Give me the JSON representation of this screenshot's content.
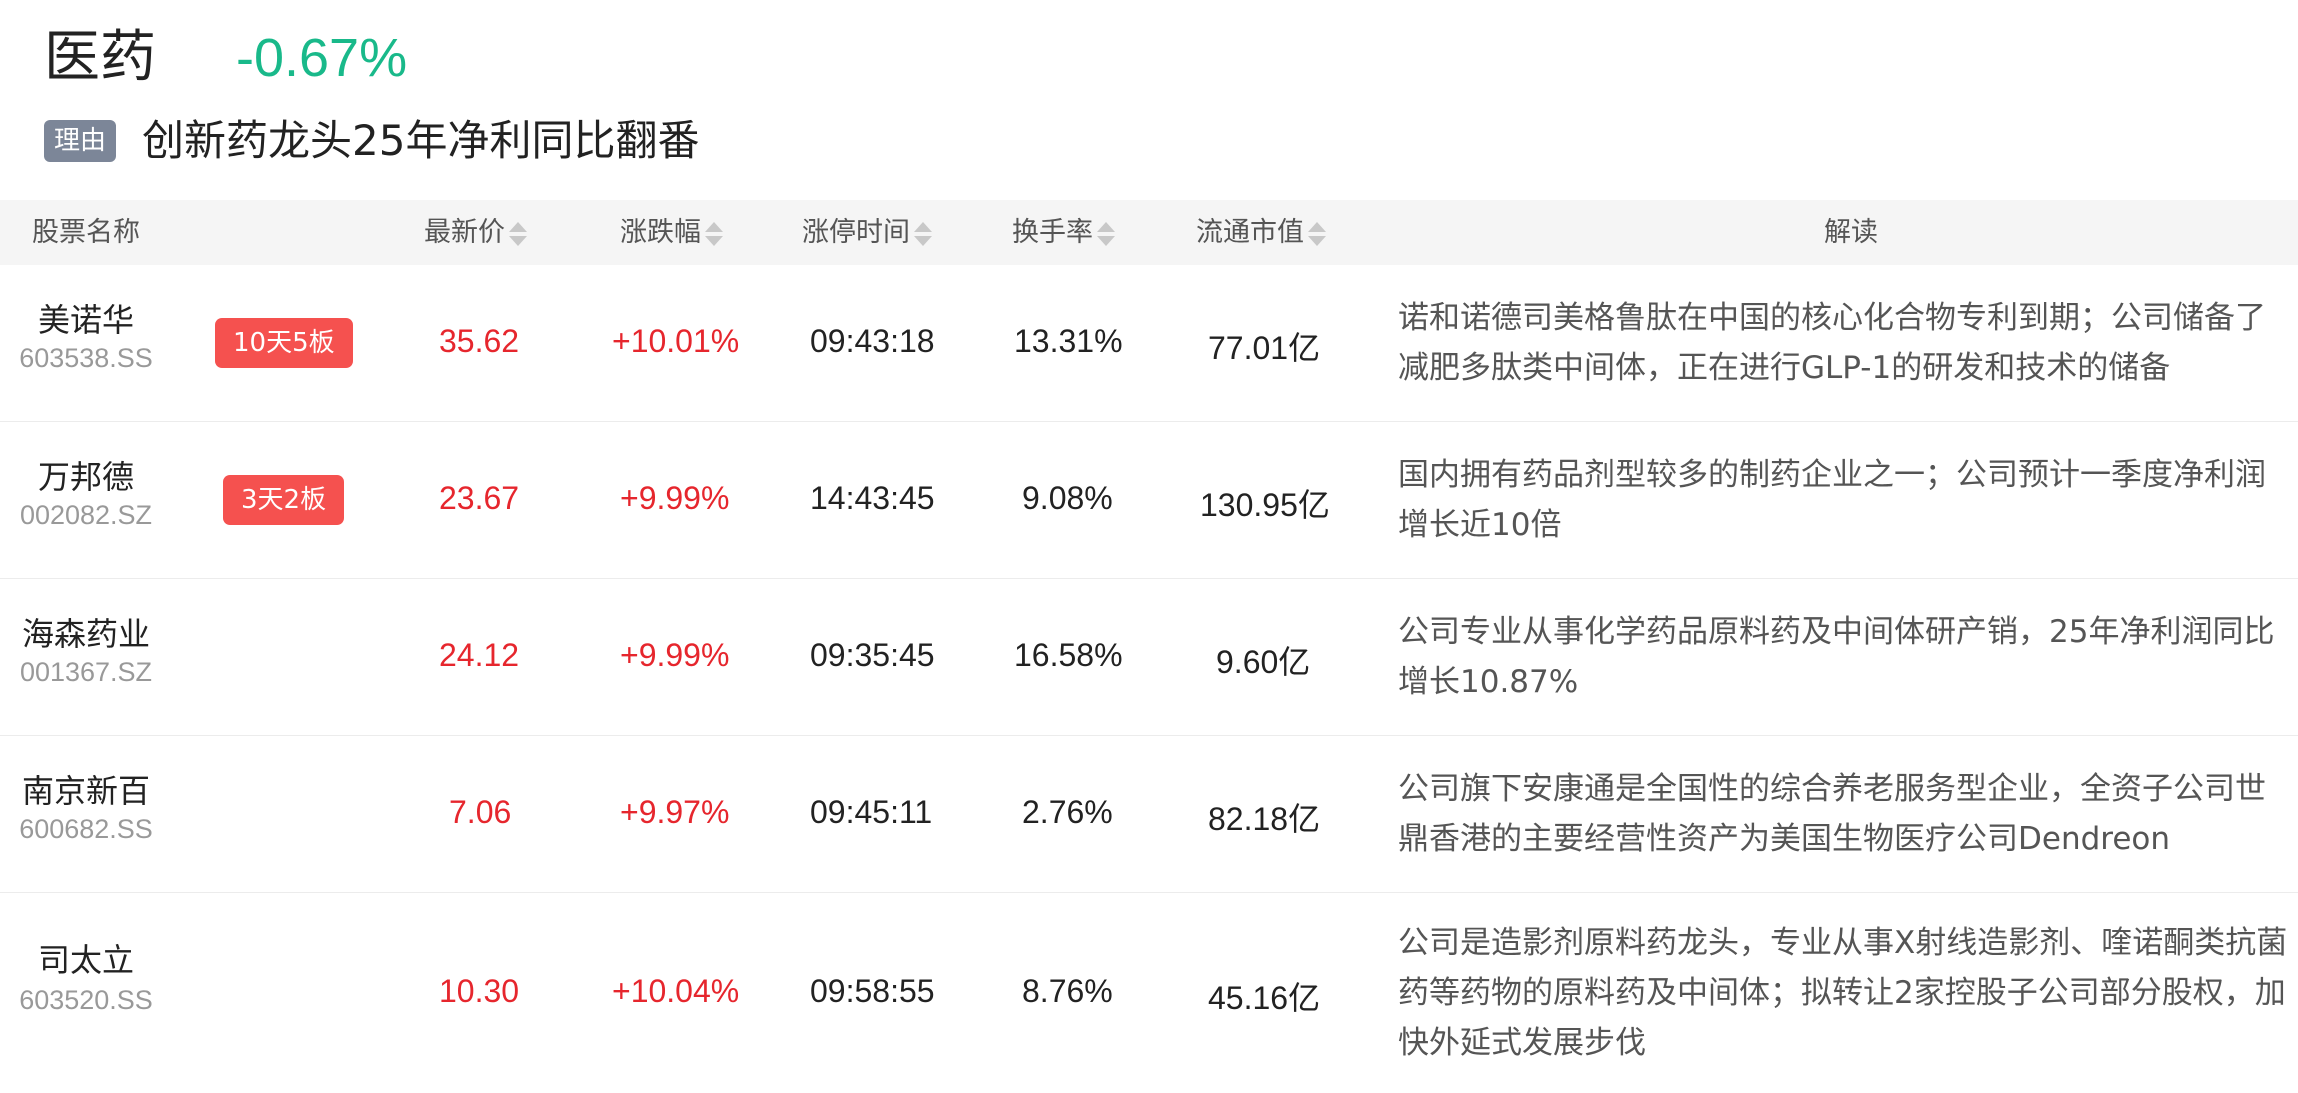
{
  "sector": {
    "name": "医药",
    "change": "-0.67%",
    "change_color": "#19b98a"
  },
  "reason": {
    "tag": "理由",
    "text": "创新药龙头25年净利同比翻番"
  },
  "columns": {
    "name": "股票名称",
    "price": "最新价",
    "change": "涨跌幅",
    "limit_time": "涨停时间",
    "turnover": "换手率",
    "market_cap": "流通市值",
    "analysis": "解读"
  },
  "rows": [
    {
      "name": "美诺华",
      "code": "603538.SS",
      "badge": "10天5板",
      "price": "35.62",
      "change": "+10.01%",
      "limit_time": "09:43:18",
      "turnover": "13.31%",
      "market_cap": "77.01亿",
      "analysis": "诺和诺德司美格鲁肽在中国的核心化合物专利到期；公司储备了减肥多肽类中间体，正在进行GLP-1的研发和技术的储备"
    },
    {
      "name": "万邦德",
      "code": "002082.SZ",
      "badge": "3天2板",
      "price": "23.67",
      "change": "+9.99%",
      "limit_time": "14:43:45",
      "turnover": "9.08%",
      "market_cap": "130.95亿",
      "analysis": "国内拥有药品剂型较多的制药企业之一；公司预计一季度净利润增长近10倍"
    },
    {
      "name": "海森药业",
      "code": "001367.SZ",
      "badge": "",
      "price": "24.12",
      "change": "+9.99%",
      "limit_time": "09:35:45",
      "turnover": "16.58%",
      "market_cap": "9.60亿",
      "analysis": "公司专业从事化学药品原料药及中间体研产销，25年净利润同比增长10.87%"
    },
    {
      "name": "南京新百",
      "code": "600682.SS",
      "badge": "",
      "price": "7.06",
      "change": "+9.97%",
      "limit_time": "09:45:11",
      "turnover": "2.76%",
      "market_cap": "82.18亿",
      "analysis": "公司旗下安康通是全国性的综合养老服务型企业，全资子公司世鼎香港的主要经营性资产为美国生物医疗公司Dendreon"
    },
    {
      "name": "司太立",
      "code": "603520.SS",
      "badge": "",
      "price": "10.30",
      "change": "+10.04%",
      "limit_time": "09:58:55",
      "turnover": "8.76%",
      "market_cap": "45.16亿",
      "analysis": "公司是造影剂原料药龙头，专业从事X射线造影剂、喹诺酮类抗菌药等药物的原料药及中间体；拟转让2家控股子公司部分股权，加快外延式发展步伐"
    }
  ]
}
